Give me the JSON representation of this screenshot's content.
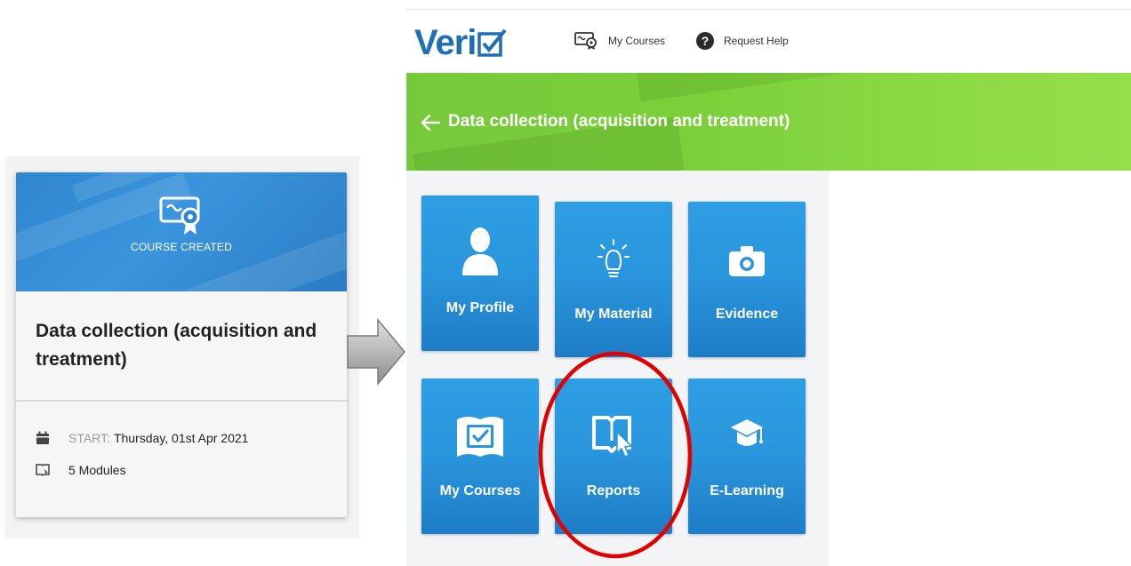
{
  "card": {
    "badge": "COURSE CREATED",
    "title": "Data collection (acquisition and treatment)",
    "start_label": "START:",
    "start_date": "Thursday, 01st Apr 2021",
    "modules": "5 Modules"
  },
  "app": {
    "logo_text": "Veri",
    "nav": {
      "my_courses": "My Courses",
      "request_help": "Request Help"
    },
    "course_title": "Data collection (acquisition and treatment)",
    "tiles": {
      "my_profile": "My Profile",
      "my_material": "My Material",
      "evidence": "Evidence",
      "my_courses": "My Courses",
      "reports": "Reports",
      "e_learning": "E-Learning"
    }
  },
  "colors": {
    "brand_blue": "#1f6fb5",
    "tile_blue": "#2a95dc",
    "hero_green": "#7bd03a",
    "highlight_red": "#e00000"
  },
  "icons": {
    "card_badge": "certificate-icon",
    "calendar": "calendar-icon",
    "modules": "book-icon",
    "nav_courses": "certificate-icon",
    "nav_help": "question-icon",
    "back": "back-arrow-icon"
  }
}
